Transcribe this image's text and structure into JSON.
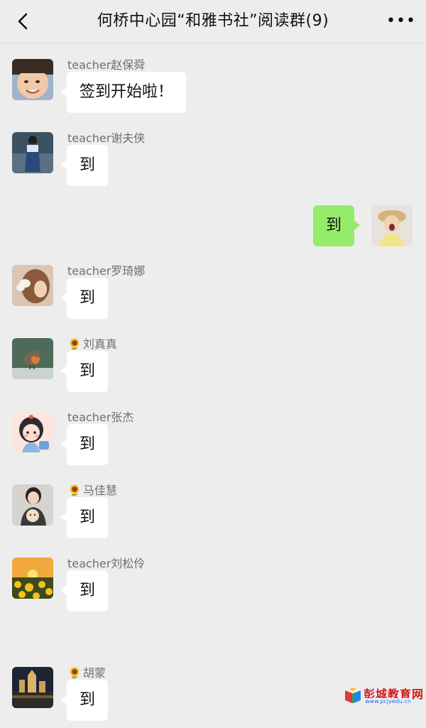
{
  "header": {
    "title": "何桥中心园“和雅书社”阅读群(9)",
    "back_icon": "chevron-left-icon",
    "more_label": "•••"
  },
  "messages": [
    {
      "side": "left",
      "sender": "teacher赵保舜",
      "text": "签到开始啦！",
      "avatar_icon": "child-photo-avatar"
    },
    {
      "side": "left",
      "sender": "teacher谢夫侠",
      "text": "到",
      "avatar_icon": "woman-back-view-avatar"
    },
    {
      "side": "right",
      "sender": "",
      "text": "到",
      "avatar_icon": "girl-straw-hat-avatar"
    },
    {
      "side": "left",
      "sender": "teacher罗琦娜",
      "text": "到",
      "avatar_icon": "girl-hair-bow-avatar"
    },
    {
      "side": "left",
      "sender": "刘真真",
      "sender_prefix": "🌻",
      "text": "到",
      "avatar_icon": "robin-bird-avatar"
    },
    {
      "side": "left",
      "sender": "teacher张杰",
      "text": "到",
      "avatar_icon": "cartoon-girl-avatar"
    },
    {
      "side": "left",
      "sender": "马佳慧",
      "sender_prefix": "🌻",
      "text": "到",
      "avatar_icon": "mother-baby-avatar"
    },
    {
      "side": "left",
      "sender": "teacher刘松伶",
      "text": "到",
      "avatar_icon": "sunflower-field-avatar"
    },
    {
      "side": "left",
      "sender": "胡蒙",
      "sender_prefix": "🌻",
      "text": "到",
      "avatar_icon": "night-castle-avatar"
    }
  ],
  "watermark": {
    "name": "彭城教育网",
    "url": "www.pcjyedu.cn"
  },
  "colors": {
    "background": "#ededed",
    "bubble_self": "#95ec69",
    "bubble_other": "#ffffff",
    "sender_name": "#6f6f6f"
  }
}
